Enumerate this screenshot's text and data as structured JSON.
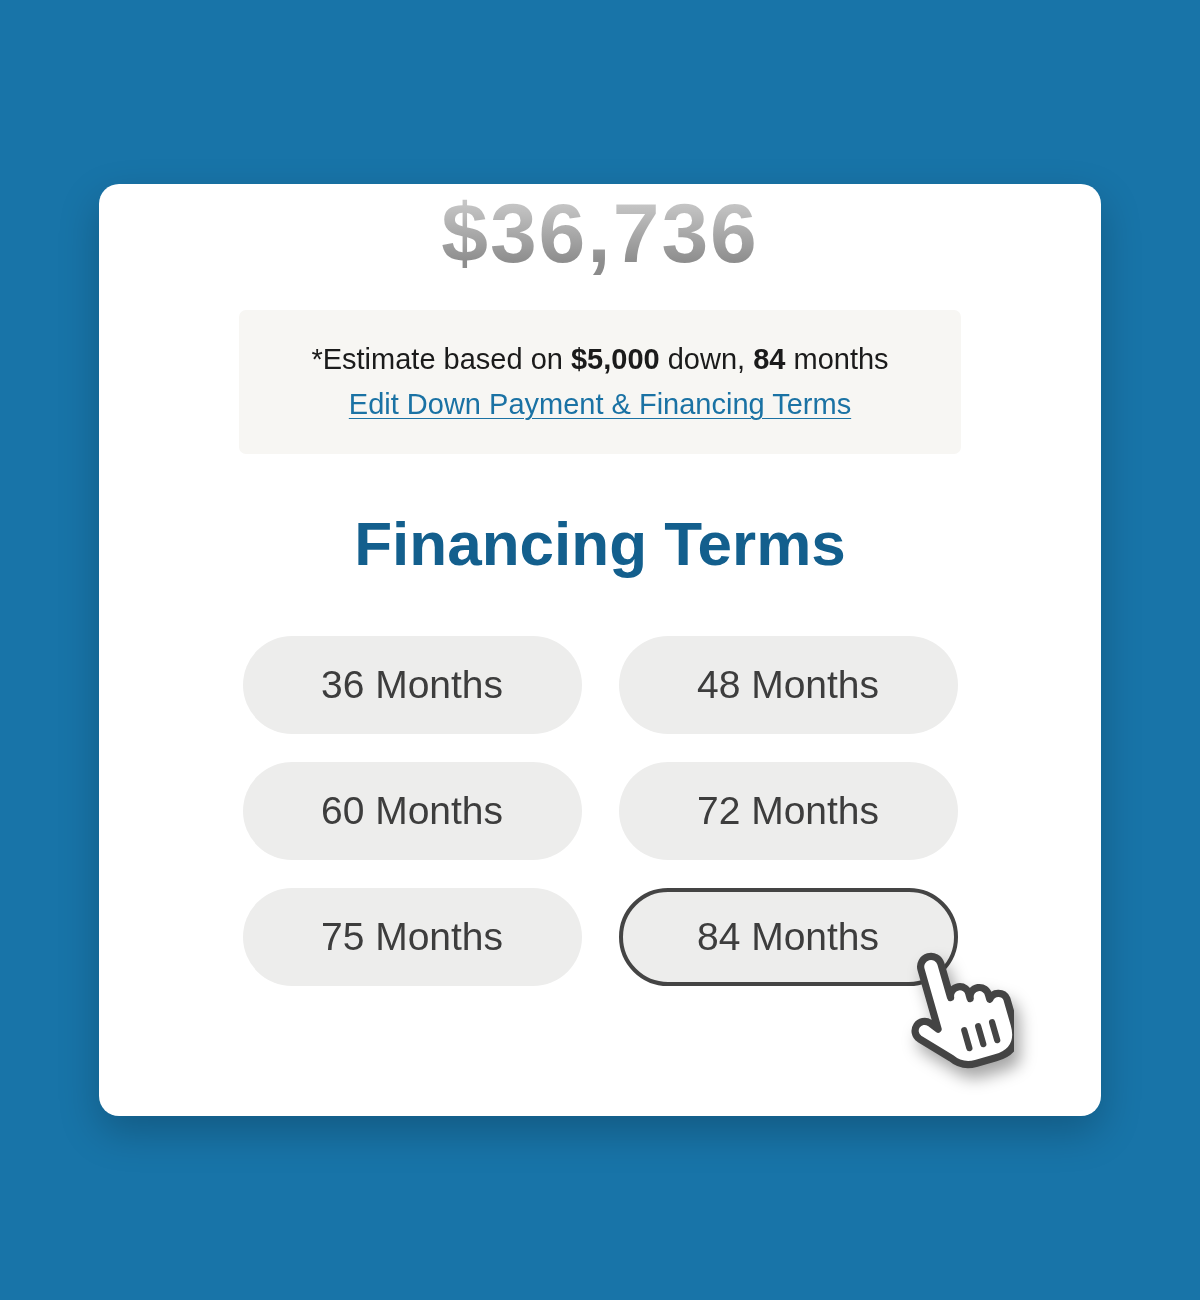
{
  "price": {
    "amount": "$36,736"
  },
  "estimate": {
    "text": "*Estimate based on **$5,000** down, **84** months",
    "link": "Edit Down Payment & Financing Terms"
  },
  "heading": "Financing Terms",
  "terms": [
    {
      "label": "36 Months",
      "selected": false
    },
    {
      "label": "48 Months",
      "selected": false
    },
    {
      "label": "60 Months",
      "selected": false
    },
    {
      "label": "72 Months",
      "selected": false
    },
    {
      "label": "75 Months",
      "selected": false
    },
    {
      "label": "84 Months",
      "selected": true
    }
  ]
}
